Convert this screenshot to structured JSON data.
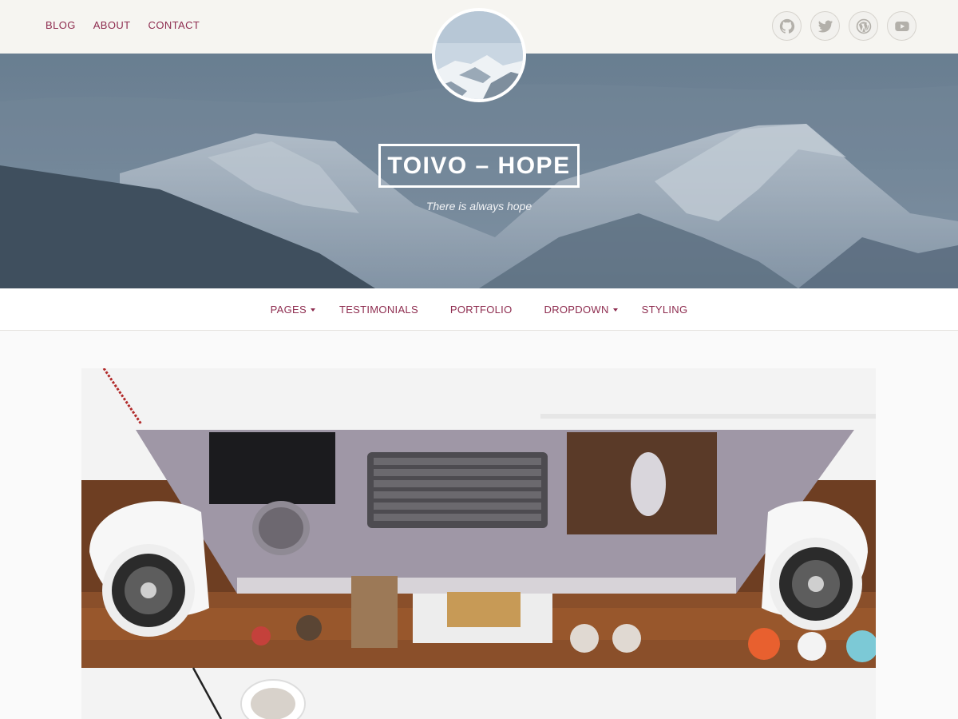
{
  "top_nav": {
    "items": [
      "BLOG",
      "ABOUT",
      "CONTACT"
    ]
  },
  "social": {
    "icons": [
      "github-icon",
      "twitter-icon",
      "wordpress-icon",
      "youtube-icon"
    ]
  },
  "hero": {
    "site_title": "TOIVO – HOPE",
    "tagline": "There is always hope"
  },
  "main_nav": {
    "items": [
      {
        "label": "PAGES",
        "has_dropdown": true
      },
      {
        "label": "TESTIMONIALS",
        "has_dropdown": false
      },
      {
        "label": "PORTFOLIO",
        "has_dropdown": false
      },
      {
        "label": "DROPDOWN",
        "has_dropdown": true
      },
      {
        "label": "STYLING",
        "has_dropdown": false
      }
    ]
  },
  "colors": {
    "accent": "#8e2c4f",
    "topbar_bg": "#f6f5f1",
    "page_bg": "#fafafa"
  }
}
